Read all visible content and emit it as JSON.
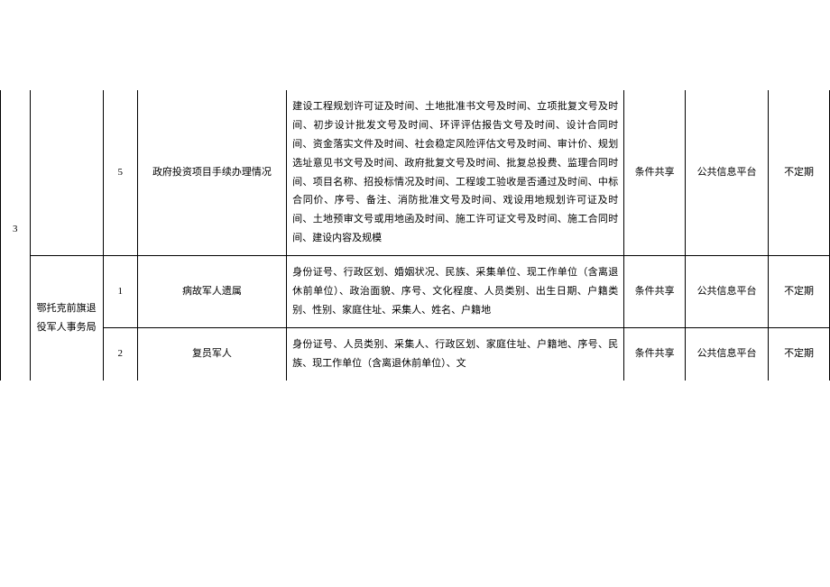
{
  "rows": [
    {
      "seq": "",
      "dept": "",
      "num": "5",
      "item": "政府投资项目手续办理情况",
      "desc": "建设工程规划许可证及时间、土地批准书文号及时间、立项批复文号及时间、初步设计批发文号及时间、环评评估报告文号及时间、设计合同时间、资金落实文件及时间、社会稳定风险评估文号及时间、审计价、规划选址意见书文号及时间、政府批复文号及时间、批复总投费、监理合同时间、项目名称、招投标情况及时间、工程竣工验收是否通过及时间、中标合同价、序号、备注、消防批准文号及时间、戏设用地规划许可证及时间、土地预审文号或用地函及时间、施工许可证文号及时间、施工合同时间、建设内容及规模",
      "share": "条件共享",
      "platform": "公共信息平台",
      "period": "不定期"
    },
    {
      "seq": "3",
      "dept": "鄂托克前旗退役军人事务局",
      "num": "1",
      "item": "病故军人遗属",
      "desc": "身份证号、行政区划、婚姻状况、民族、采集单位、现工作单位（含离退休前单位）、政治面貌、序号、文化程度、人员类别、出生日期、户籍类别、性别、家庭住址、采集人、姓名、户籍地",
      "share": "条件共享",
      "platform": "公共信息平台",
      "period": "不定期"
    },
    {
      "num": "2",
      "item": "复员军人",
      "desc": "身份证号、人员类别、采集人、行政区划、家庭住址、户籍地、序号、民族、现工作单位（含离退休前单位）、文",
      "share": "条件共享",
      "platform": "公共信息平台",
      "period": "不定期"
    }
  ]
}
